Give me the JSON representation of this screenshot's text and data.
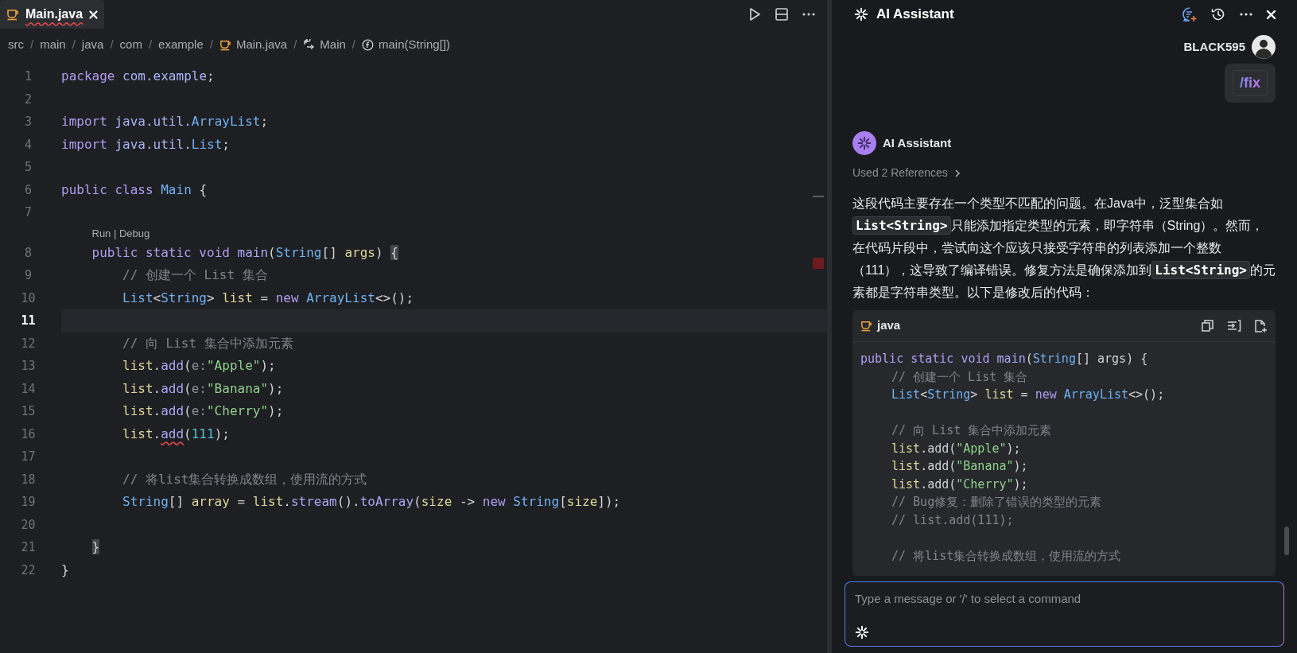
{
  "editor": {
    "tab": {
      "label": "Main.java",
      "selected": true,
      "error": true
    },
    "breadcrumb": {
      "separator": "/",
      "items": [
        {
          "kind": "folder",
          "label": "src"
        },
        {
          "kind": "folder",
          "label": "main"
        },
        {
          "kind": "folder",
          "label": "java"
        },
        {
          "kind": "folder",
          "label": "com"
        },
        {
          "kind": "folder",
          "label": "example"
        },
        {
          "kind": "file",
          "label": "Main.java"
        },
        {
          "kind": "class",
          "label": "Main"
        },
        {
          "kind": "method",
          "label": "main(String[])"
        }
      ]
    },
    "lines": [
      {
        "number": "1",
        "current": false,
        "tokens": [
          {
            "kind": "keyword",
            "text": "package "
          },
          {
            "kind": "package",
            "text": "com.example"
          },
          {
            "kind": "plain",
            "text": ";"
          }
        ]
      },
      {
        "number": "2",
        "current": false
      },
      {
        "number": "3",
        "current": false,
        "tokens": [
          {
            "kind": "keyword",
            "text": "import "
          },
          {
            "kind": "package",
            "text": "java.util."
          },
          {
            "kind": "type",
            "text": "ArrayList"
          },
          {
            "kind": "plain",
            "text": ";"
          }
        ]
      },
      {
        "number": "4",
        "current": false,
        "tokens": [
          {
            "kind": "keyword",
            "text": "import "
          },
          {
            "kind": "package",
            "text": "java.util."
          },
          {
            "kind": "type",
            "text": "List"
          },
          {
            "kind": "plain",
            "text": ";"
          }
        ]
      },
      {
        "number": "5",
        "current": false
      },
      {
        "number": "6",
        "current": false,
        "tokens": [
          {
            "kind": "keyword",
            "text": "public class "
          },
          {
            "kind": "type",
            "text": "Main "
          },
          {
            "kind": "plain",
            "text": "{"
          }
        ],
        "children": [
          {
            "number": "7",
            "current": false
          },
          {
            "number": "8",
            "current": false,
            "lens": "Run | Debug",
            "tokens": [
              {
                "kind": "keyword",
                "text": "public static void "
              },
              {
                "kind": "method",
                "text": "main"
              },
              {
                "kind": "plain",
                "text": "("
              },
              {
                "kind": "type",
                "text": "String"
              },
              {
                "kind": "plain",
                "text": "[] "
              },
              {
                "kind": "var",
                "text": "args"
              },
              {
                "kind": "plain",
                "text": ") "
              },
              {
                "kind": "bracket",
                "text": "{"
              }
            ],
            "children": [
              {
                "number": "9",
                "current": false,
                "tokens": [
                  {
                    "kind": "comment",
                    "text": "// 创建一个 List 集合"
                  }
                ]
              },
              {
                "number": "10",
                "current": false,
                "tokens": [
                  {
                    "kind": "type",
                    "text": "List"
                  },
                  {
                    "kind": "plain",
                    "text": "<"
                  },
                  {
                    "kind": "type",
                    "text": "String"
                  },
                  {
                    "kind": "plain",
                    "text": "> "
                  },
                  {
                    "kind": "var",
                    "text": "list"
                  },
                  {
                    "kind": "plain",
                    "text": " = "
                  },
                  {
                    "kind": "keyword",
                    "text": "new "
                  },
                  {
                    "kind": "type",
                    "text": "ArrayList"
                  },
                  {
                    "kind": "plain",
                    "text": "<>();"
                  }
                ]
              },
              {
                "number": "11",
                "current": true
              },
              {
                "number": "12",
                "current": false,
                "tokens": [
                  {
                    "kind": "comment",
                    "text": "// 向 List 集合中添加元素"
                  }
                ]
              },
              {
                "number": "13",
                "current": false,
                "tokens": [
                  {
                    "kind": "var",
                    "text": "list"
                  },
                  {
                    "kind": "plain",
                    "text": "."
                  },
                  {
                    "kind": "method",
                    "text": "add"
                  },
                  {
                    "kind": "plain",
                    "text": "("
                  },
                  {
                    "kind": "hint",
                    "text": "e:"
                  },
                  {
                    "kind": "string",
                    "text": "\"Apple\""
                  },
                  {
                    "kind": "plain",
                    "text": ");"
                  }
                ]
              },
              {
                "number": "14",
                "current": false,
                "tokens": [
                  {
                    "kind": "var",
                    "text": "list"
                  },
                  {
                    "kind": "plain",
                    "text": "."
                  },
                  {
                    "kind": "method",
                    "text": "add"
                  },
                  {
                    "kind": "plain",
                    "text": "("
                  },
                  {
                    "kind": "hint",
                    "text": "e:"
                  },
                  {
                    "kind": "string",
                    "text": "\"Banana\""
                  },
                  {
                    "kind": "plain",
                    "text": ");"
                  }
                ]
              },
              {
                "number": "15",
                "current": false,
                "tokens": [
                  {
                    "kind": "var",
                    "text": "list"
                  },
                  {
                    "kind": "plain",
                    "text": "."
                  },
                  {
                    "kind": "method",
                    "text": "add"
                  },
                  {
                    "kind": "plain",
                    "text": "("
                  },
                  {
                    "kind": "hint",
                    "text": "e:"
                  },
                  {
                    "kind": "string",
                    "text": "\"Cherry\""
                  },
                  {
                    "kind": "plain",
                    "text": ");"
                  }
                ]
              },
              {
                "number": "16",
                "current": false,
                "tokens": [
                  {
                    "kind": "var",
                    "text": "list"
                  },
                  {
                    "kind": "plain",
                    "text": "."
                  },
                  {
                    "kind": "method",
                    "text": "add",
                    "error": true
                  },
                  {
                    "kind": "plain",
                    "text": "("
                  },
                  {
                    "kind": "number",
                    "text": "111"
                  },
                  {
                    "kind": "plain",
                    "text": ");"
                  }
                ]
              },
              {
                "number": "17",
                "current": false
              },
              {
                "number": "18",
                "current": false,
                "tokens": [
                  {
                    "kind": "comment",
                    "text": "// 将list集合转换成数组，使用流的方式"
                  }
                ]
              },
              {
                "number": "19",
                "current": false,
                "tokens": [
                  {
                    "kind": "type",
                    "text": "String"
                  },
                  {
                    "kind": "plain",
                    "text": "[] "
                  },
                  {
                    "kind": "var",
                    "text": "array"
                  },
                  {
                    "kind": "plain",
                    "text": " = "
                  },
                  {
                    "kind": "var",
                    "text": "list"
                  },
                  {
                    "kind": "plain",
                    "text": "."
                  },
                  {
                    "kind": "method",
                    "text": "stream"
                  },
                  {
                    "kind": "plain",
                    "text": "()."
                  },
                  {
                    "kind": "method",
                    "text": "toArray"
                  },
                  {
                    "kind": "plain",
                    "text": "("
                  },
                  {
                    "kind": "var",
                    "text": "size"
                  },
                  {
                    "kind": "plain",
                    "text": " -> "
                  },
                  {
                    "kind": "keyword",
                    "text": "new "
                  },
                  {
                    "kind": "type",
                    "text": "String"
                  },
                  {
                    "kind": "plain",
                    "text": "["
                  },
                  {
                    "kind": "var",
                    "text": "size"
                  },
                  {
                    "kind": "plain",
                    "text": "]);"
                  }
                ]
              },
              {
                "number": "20",
                "current": false
              }
            ]
          },
          {
            "number": "21",
            "current": false,
            "tokens": [
              {
                "kind": "bracket",
                "text": "}"
              }
            ]
          }
        ]
      },
      {
        "number": "22",
        "current": false,
        "tokens": [
          {
            "kind": "plain",
            "text": "}"
          }
        ]
      }
    ]
  },
  "assistant": {
    "title": "AI Assistant",
    "user": {
      "name": "BLACK595",
      "command": "/fix"
    },
    "reply": {
      "author": "AI Assistant",
      "references": "Used 2 References",
      "paragraph": [
        {
          "kind": "text",
          "text": "这段代码主要存在一个类型不匹配的问题。在Java中，泛型集合如"
        },
        {
          "kind": "code",
          "text": "List<String>"
        },
        {
          "kind": "text",
          "text": "只能添加指定类型的元素，即字符串（String）。然而，在代码片段中，尝试向这个应该只接受字符串的列表添加一个整数（111），这导致了编译错误。修复方法是确保添加到"
        },
        {
          "kind": "code",
          "text": "List<String>"
        },
        {
          "kind": "text",
          "text": "的元素都是字符串类型。以下是修改后的代码："
        }
      ],
      "snippet": {
        "language": "java",
        "lines": [
          {
            "tokens": [
              {
                "kind": "keyword",
                "text": "public static void "
              },
              {
                "kind": "method",
                "text": "main"
              },
              {
                "kind": "plain",
                "text": "("
              },
              {
                "kind": "type",
                "text": "String"
              },
              {
                "kind": "plain",
                "text": "[] args) {"
              }
            ],
            "children": [
              {
                "tokens": [
                  {
                    "kind": "comment",
                    "text": "// 创建一个 List 集合"
                  }
                ]
              },
              {
                "tokens": [
                  {
                    "kind": "type",
                    "text": "List"
                  },
                  {
                    "kind": "plain",
                    "text": "<"
                  },
                  {
                    "kind": "type",
                    "text": "String"
                  },
                  {
                    "kind": "plain",
                    "text": "> "
                  },
                  {
                    "kind": "var",
                    "text": "list"
                  },
                  {
                    "kind": "plain",
                    "text": " = "
                  },
                  {
                    "kind": "keyword",
                    "text": "new "
                  },
                  {
                    "kind": "type",
                    "text": "ArrayList"
                  },
                  {
                    "kind": "plain",
                    "text": "<>();"
                  }
                ]
              },
              {
                "blank_before": true,
                "tokens": [
                  {
                    "kind": "comment",
                    "text": "// 向 List 集合中添加元素"
                  }
                ]
              },
              {
                "tokens": [
                  {
                    "kind": "var",
                    "text": "list"
                  },
                  {
                    "kind": "plain",
                    "text": ".add("
                  },
                  {
                    "kind": "string",
                    "text": "\"Apple\""
                  },
                  {
                    "kind": "plain",
                    "text": ");"
                  }
                ]
              },
              {
                "tokens": [
                  {
                    "kind": "var",
                    "text": "list"
                  },
                  {
                    "kind": "plain",
                    "text": ".add("
                  },
                  {
                    "kind": "string",
                    "text": "\"Banana\""
                  },
                  {
                    "kind": "plain",
                    "text": ");"
                  }
                ]
              },
              {
                "tokens": [
                  {
                    "kind": "var",
                    "text": "list"
                  },
                  {
                    "kind": "plain",
                    "text": ".add("
                  },
                  {
                    "kind": "string",
                    "text": "\"Cherry\""
                  },
                  {
                    "kind": "plain",
                    "text": ");"
                  }
                ]
              },
              {
                "tokens": [
                  {
                    "kind": "comment",
                    "text": "// Bug修复：删除了错误的类型的元素"
                  }
                ]
              },
              {
                "tokens": [
                  {
                    "kind": "comment",
                    "text": "// list.add(111);"
                  }
                ]
              },
              {
                "blank_before": true,
                "tokens": [
                  {
                    "kind": "comment",
                    "text": "// 将list集合转换成数组，使用流的方式"
                  }
                ]
              }
            ]
          }
        ]
      }
    },
    "input": {
      "placeholder": "Type a message or '/' to select a command"
    }
  }
}
